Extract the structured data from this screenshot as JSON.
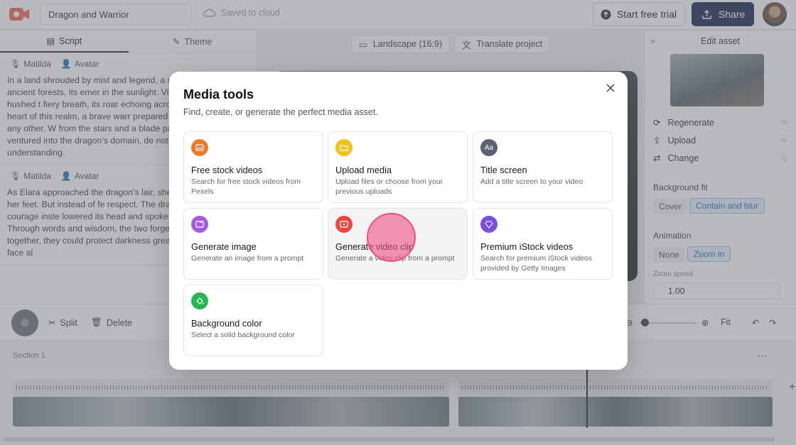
{
  "header": {
    "project_name": "Dragon and Warrior",
    "saved_status": "Saved to cloud",
    "trial_label": "Start free trial",
    "share_label": "Share"
  },
  "left_panel": {
    "tabs": [
      {
        "label": "Script"
      },
      {
        "label": "Theme"
      }
    ],
    "blocks": [
      {
        "voice": "Matilda",
        "avatar": "Avatar",
        "text": "In a land shrouded by mist and legend, a m soared above the ancient forests, its emer in the sunlight. Villagers spoke in hushed t fiery breath, its roar echoing across the m within the heart of this realm, a brave warr prepared for a journey unlike any other. W from the stars and a blade passed down th she ventured into the dragon’s domain, de not vengeance, but understanding."
      },
      {
        "voice": "Matilda",
        "avatar": "Avatar",
        "text": "As Elara approached the dragon’s lair, she tremble beneath her feet. But instead of fe respect. The dragon, seeing courage inste lowered its head and spoke in a voice as o Through words and wisdom, the two forge realizing that together, they could protect darkness greater than either could face al"
      }
    ]
  },
  "center": {
    "orientation": "Landscape (16:9)",
    "translate": "Translate project"
  },
  "right_panel": {
    "title": "Edit asset",
    "actions": [
      {
        "label": "Regenerate",
        "key": "R"
      },
      {
        "label": "Upload",
        "key": "W"
      },
      {
        "label": "Change",
        "key": "Q"
      }
    ],
    "background_fit": {
      "label": "Background fit",
      "options": [
        "Cover",
        "Contain and blur"
      ],
      "selected": "Contain and blur"
    },
    "animation": {
      "label": "Animation",
      "options": [
        "None",
        "Zoom in"
      ],
      "selected": "Zoom in"
    },
    "zoom_speed": {
      "label": "Zoom speed",
      "value": "1.00"
    }
  },
  "toolbar": {
    "split": "Split",
    "delete": "Delete",
    "fit": "Fit"
  },
  "timeline": {
    "section_label": "Section 1"
  },
  "modal": {
    "title": "Media tools",
    "subtitle": "Find, create, or generate the perfect media asset.",
    "cards": [
      {
        "title": "Free stock videos",
        "desc": "Search for free stock videos from Pexels",
        "icon": "image-icon",
        "color": "#ec7a2b"
      },
      {
        "title": "Upload media",
        "desc": "Upload files or choose from your previous uploads",
        "icon": "folder-icon",
        "color": "#f2c21b"
      },
      {
        "title": "Title screen",
        "desc": "Add a title screen to your video",
        "icon": "text-icon",
        "color": "#5a6170"
      },
      {
        "title": "Generate image",
        "desc": "Generate an image from a prompt",
        "icon": "sparkle-image-icon",
        "color": "#a55be0"
      },
      {
        "title": "Generate video clip",
        "desc": "Generate a video clip from a prompt",
        "icon": "video-sparkle-icon",
        "color": "#e8483f"
      },
      {
        "title": "Premium iStock videos",
        "desc": "Search for premium iStock videos provided by Getty Images",
        "icon": "diamond-icon",
        "color": "#7a4fe0"
      },
      {
        "title": "Background color",
        "desc": "Select a solid background color",
        "icon": "paint-bucket-icon",
        "color": "#26b653"
      }
    ]
  }
}
